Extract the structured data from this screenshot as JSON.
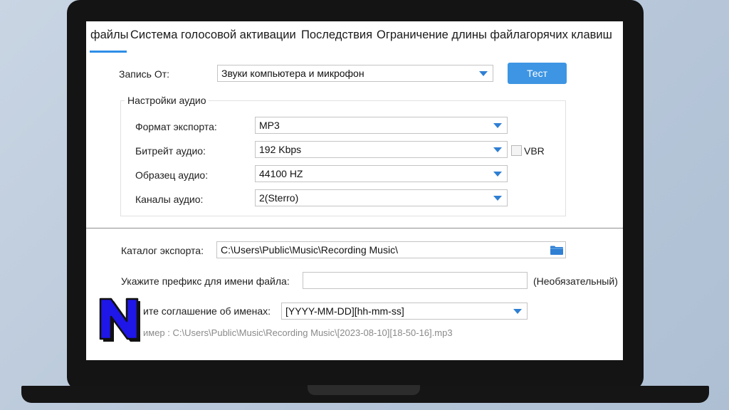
{
  "tabs": [
    {
      "label": "файлы",
      "active": true
    },
    {
      "label": "Система голосовой активации",
      "active": false
    },
    {
      "label": "Последствия",
      "active": false
    },
    {
      "label": "Ограничение длины файла",
      "active": false
    },
    {
      "label": "горячих клавиш",
      "active": false
    }
  ],
  "record_from": {
    "label": "Запись От:",
    "value": "Звуки компьютера и микрофон",
    "test_button": "Тест"
  },
  "audio_settings": {
    "title": "Настройки аудио",
    "format": {
      "label": "Формат экспорта:",
      "value": "MP3"
    },
    "bitrate": {
      "label": "Битрейт аудио:",
      "value": "192 Kbps",
      "vbr_label": "VBR",
      "vbr_checked": false
    },
    "sample": {
      "label": "Образец аудио:",
      "value": "44100 HZ"
    },
    "channels": {
      "label": "Каналы аудио:",
      "value": "2(Sterro)"
    }
  },
  "export": {
    "catalog_label": "Каталог экспорта:",
    "catalog_value": "C:\\Users\\Public\\Music\\Recording Music\\",
    "prefix_label": "Укажите префикс для имени файла:",
    "prefix_value": "",
    "prefix_hint": "(Необязательный)",
    "naming_label": "ите соглашение об именах:",
    "naming_value": "[YYYY-MM-DD][hh-mm-ss]",
    "example": "имер : C:\\Users\\Public\\Music\\Recording Music\\[2023-08-10][18-50-16].mp3"
  },
  "colors": {
    "accent": "#2d8ee8",
    "button": "#3d95e3",
    "logo_fill": "#1f16e8"
  },
  "icons": {
    "folder": "folder-icon",
    "logo": "n-logo-icon"
  }
}
